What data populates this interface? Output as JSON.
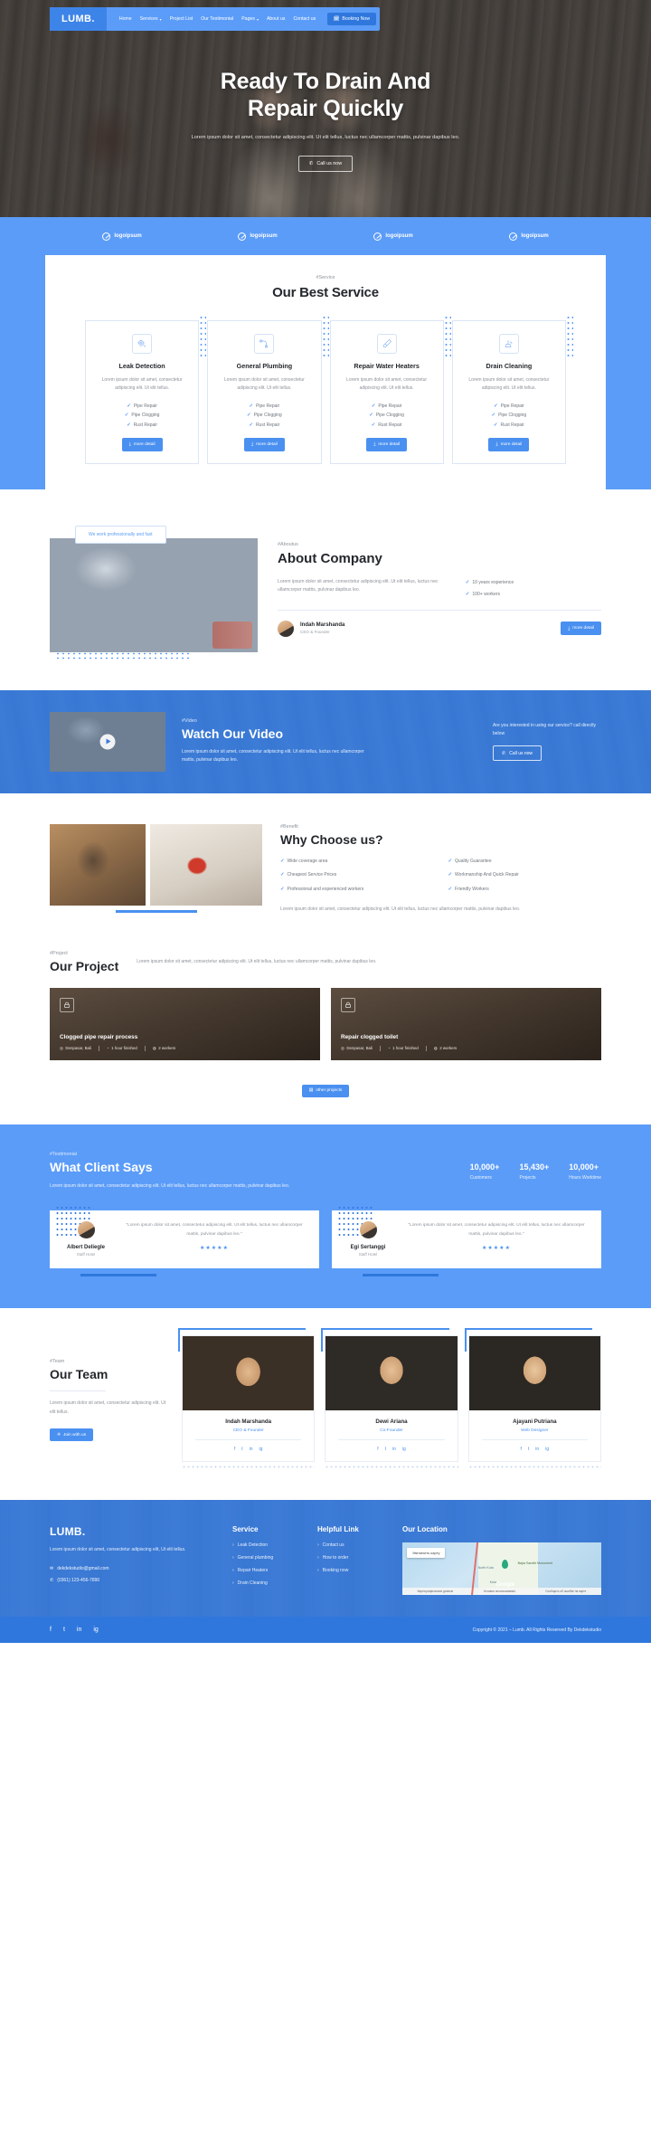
{
  "nav": {
    "brand": "LUMB.",
    "links": [
      {
        "label": "Home",
        "caret": false
      },
      {
        "label": "Services",
        "caret": true
      },
      {
        "label": "Project List",
        "caret": false
      },
      {
        "label": "Our Testimonial",
        "caret": false
      },
      {
        "label": "Pages",
        "caret": true
      },
      {
        "label": "About us",
        "caret": false
      },
      {
        "label": "Contact us",
        "caret": false
      }
    ],
    "booking_label": "Booking Now",
    "booking_icon": "calendar-icon"
  },
  "hero": {
    "title_line1": "Ready To Drain And",
    "title_line2": "Repair Quickly",
    "paragraph": "Lorem ipsum dolor sit amet, consectetur adipiscing elit. Ut elit tellus, luctus nec ullamcorper mattis, pulvinar dapibus leo.",
    "cta_label": "Call us now",
    "cta_icon": "phone-icon"
  },
  "logos": [
    {
      "label": "logoipsum"
    },
    {
      "label": "logoipsum"
    },
    {
      "label": "logoipsum"
    },
    {
      "label": "logoipsum"
    }
  ],
  "service": {
    "tagline": "#Service",
    "title": "Our Best Service",
    "cards": [
      {
        "icon": "leak-detection-icon",
        "title": "Leak Detection",
        "desc": "Lorem ipsum dolor sit amet, consectetur adipiscing elit. Ut elit tellus.",
        "features": [
          "Pipe Repair",
          "Pipe Clogging",
          "Rust Repair"
        ],
        "button": "more detail"
      },
      {
        "icon": "pipe-elbow-icon",
        "title": "General Plumbing",
        "desc": "Lorem ipsum dolor sit amet, consectetur adipiscing elit. Ut elit tellus.",
        "features": [
          "Pipe Repair",
          "Pipe Clogging",
          "Rust Repair"
        ],
        "button": "more detail"
      },
      {
        "icon": "screwdriver-icon",
        "title": "Repair Water Heaters",
        "desc": "Lorem ipsum dolor sit amet, consectetur adipiscing elit. Ut elit tellus.",
        "features": [
          "Pipe Repair",
          "Pipe Clogging",
          "Rust Repair"
        ],
        "button": "more detail"
      },
      {
        "icon": "drain-cleaning-icon",
        "title": "Drain Cleaning",
        "desc": "Lorem ipsum dolor sit amet, consectetur adipiscing elit. Ut elit tellus.",
        "features": [
          "Pipe Repair",
          "Pipe Clogging",
          "Rust Repair"
        ],
        "button": "more detail"
      }
    ]
  },
  "about": {
    "badge": "We work professionally and fast",
    "tagline": "#Aboutus",
    "title": "About Company",
    "paragraph": "Lorem ipsum dolor sit amet, consectetur adipiscing elit. Ut elit tellus, luctus nec ullamcorper mattis, pulvinar dapibus leo.",
    "checks": [
      "10 years experience",
      "100+ workers"
    ],
    "founder_name": "Indah Marshanda",
    "founder_role": "CEO & Founder",
    "button": "more detail"
  },
  "video": {
    "tagline": "#Video",
    "title": "Watch Our Video",
    "paragraph": "Lorem ipsum dolor sit amet, consectetur adipiscing elit. Ut elit tellus, luctus nec ullamcorper mattis, pulvinar dapibus leo.",
    "side_text": "Are you interested in using our service? call directly below",
    "cta_label": "Call us now",
    "cta_icon": "phone-icon",
    "play_icon": "play-icon"
  },
  "why": {
    "tagline": "#Benefit",
    "title": "Why Choose us?",
    "col1": [
      "Wide coverage area",
      "Cheapest Service Prices",
      "Professional and experienced workers"
    ],
    "col2": [
      "Quality Guarantee",
      "Workmanship And Quick Repair",
      "Friendly Workers"
    ],
    "note": "Lorem ipsum dolor sit amet, consectetur adipiscing elit. Ut elit tellus, luctus nec ullamcorper mattis, pulvinar dapibus leo."
  },
  "project": {
    "tagline": "#Project",
    "title": "Our Project",
    "desc": "Lorem ipsum dolor sit amet, consectetur adipiscing elit. Ut elit tellus, luctus nec ullamcorper mattis, pulvinar dapibus leo.",
    "items": [
      {
        "icon": "lock-icon",
        "title": "Clogged pipe repair process",
        "location": "Denpasar, Bali",
        "duration": "1 hour finished",
        "workers": "2 workers"
      },
      {
        "icon": "lock-icon",
        "title": "Repair clogged toilet",
        "location": "Denpasar, Bali",
        "duration": "1 hour finished",
        "workers": "2 workers"
      }
    ],
    "button": "other projects"
  },
  "testimonial": {
    "tagline": "#Testimonial",
    "title": "What Client Says",
    "paragraph": "Lorem ipsum dolor sit amet, consectetur adipiscing elit. Ut elit tellus, luctus nec ullamcorper mattis, pulvinar dapibus leo.",
    "stats": [
      {
        "value": "10,000+",
        "label": "Customers"
      },
      {
        "value": "15,430+",
        "label": "Projects"
      },
      {
        "value": "10,000+",
        "label": "Hours Worktime"
      }
    ],
    "cards": [
      {
        "name": "Albert Deliegle",
        "role": "Staff Hotel",
        "quote": "\"Lorem ipsum dolor sit amet, consectetur adipiscing elit. Ut elit tellus, luctus nec ullamcorper mattis, pulvinar dapibus leo.\"",
        "stars": "★★★★★"
      },
      {
        "name": "Egi Sertanggi",
        "role": "Staff Hotel",
        "quote": "\"Lorem ipsum dolor sit amet, consectetur adipiscing elit. Ut elit tellus, luctus nec ullamcorper mattis, pulvinar dapibus leo.\"",
        "stars": "★★★★★"
      }
    ]
  },
  "team": {
    "tagline": "#Team",
    "title": "Our Team",
    "paragraph": "Lorem ipsum dolor sit amet, consectetur adipiscing elit. Ut elit tellus.",
    "button": "Join with us",
    "members": [
      {
        "name": "Indah Marshanda",
        "role": "CEO & Founder"
      },
      {
        "name": "Dewi Ariana",
        "role": "Co-Founder"
      },
      {
        "name": "Ajayani Putriana",
        "role": "Web Designer"
      }
    ],
    "socials": [
      "f",
      "t",
      "in",
      "ig"
    ]
  },
  "footer": {
    "logo": "LUMB.",
    "desc": "Lorem ipsum dolor sit amet, consectetur adipiscing elit, Ut elit tellus.",
    "email": "dekdekstudio@gmail.com",
    "phone": "(0361) 123-456-7890",
    "service_heading": "Service",
    "service_links": [
      "Leak Detection",
      "General plumbing",
      "Repair Heaters",
      "Drain Cleaning"
    ],
    "helpful_heading": "Helpful Link",
    "helpful_links": [
      "Contact us",
      "How to order",
      "Booking now"
    ],
    "location_heading": "Our Location",
    "map_button": "Увеличить карту",
    "map_labels": [
      "North Kuta",
      "Bajra Sandhi Monument",
      "Kuta"
    ],
    "map_google": "Google",
    "map_footer": [
      "Картографические данные",
      "Условия использования",
      "Сообщить об ошибке на карте"
    ],
    "copyright": "Copyright © 2021 – Lumb. All Rights Reserved By Dekdekstudio",
    "socials": [
      "f",
      "t",
      "in",
      "ig"
    ]
  },
  "colors": {
    "primary": "#5b9cf8",
    "primary_dark": "#2f77dd",
    "button": "#4a90f0",
    "heading": "#24282d",
    "muted": "#8b9199"
  }
}
